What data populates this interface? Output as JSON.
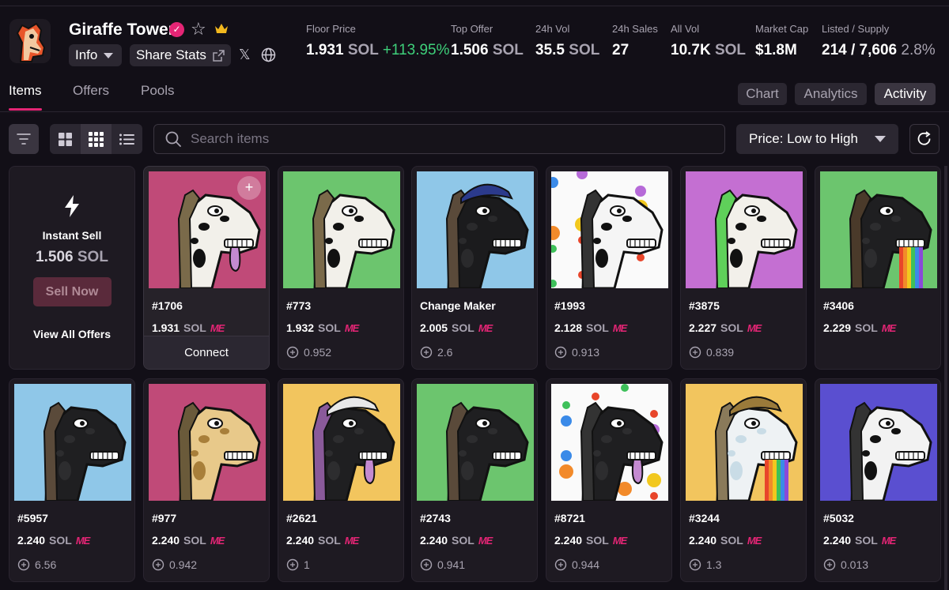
{
  "collection": {
    "name": "Giraffe Tower",
    "info_label": "Info",
    "share_label": "Share Stats"
  },
  "stats": [
    {
      "label": "Floor Price",
      "value": "1.931",
      "unit": "SOL",
      "extra": "+113.95%"
    },
    {
      "label": "Top Offer",
      "value": "1.506",
      "unit": "SOL"
    },
    {
      "label": "24h Vol",
      "value": "35.5",
      "unit": "SOL"
    },
    {
      "label": "24h Sales",
      "value": "27"
    },
    {
      "label": "All Vol",
      "value": "10.7K",
      "unit": "SOL"
    },
    {
      "label": "Market Cap",
      "value": "$1.8M"
    },
    {
      "label": "Listed / Supply",
      "value": "214 / 7,606",
      "extra": "2.8%"
    }
  ],
  "tabs": [
    "Items",
    "Offers",
    "Pools"
  ],
  "views": [
    "Chart",
    "Analytics",
    "Activity"
  ],
  "search": {
    "placeholder": "Search items"
  },
  "sort": {
    "selected": "Price: Low to High"
  },
  "instant_sell": {
    "title": "Instant Sell",
    "price": "1.506",
    "unit": "SOL",
    "button": "Sell Now",
    "view_all": "View All Offers"
  },
  "price_unit": "SOL",
  "marketplace_mark": "ME",
  "connect_label": "Connect",
  "items": [
    {
      "name": "#1706",
      "price": "1.931",
      "last": "",
      "bg": "#c04a78",
      "body": "#f2f0ea",
      "spots": "#111111",
      "mane": "#7a6a4a",
      "tongue": true
    },
    {
      "name": "#773",
      "price": "1.932",
      "last": "0.952",
      "bg": "#6cc56e",
      "body": "#f2f0ea",
      "spots": "#111111",
      "mane": "#7a6a4a"
    },
    {
      "name": "Change Maker",
      "price": "2.005",
      "last": "2.6",
      "bg": "#8fc7e8",
      "body": "#1b1b1d",
      "spots": "#2a2a2c",
      "mane": "#5a4a3a",
      "hat": "#2b3a8c"
    },
    {
      "name": "#1993",
      "price": "2.128",
      "last": "0.913",
      "bg": "#fafafa",
      "body": "#f5f5f5",
      "spots": "#111111",
      "mane": "#333333",
      "dots": true
    },
    {
      "name": "#3875",
      "price": "2.227",
      "last": "0.839",
      "bg": "#c46fd2",
      "body": "#f2f0ea",
      "spots": "#111111",
      "mane": "#5fd05a"
    },
    {
      "name": "#3406",
      "price": "2.229",
      "last": "",
      "bg": "#6cc56e",
      "body": "#1f1f21",
      "spots": "#2d2d2f",
      "mane": "#4a3a2a",
      "rainbow": true
    },
    {
      "name": "#5957",
      "price": "2.240",
      "last": "6.56",
      "bg": "#8fc7e8",
      "body": "#1f1f21",
      "spots": "#2d2d2f",
      "mane": "#5a4a3a"
    },
    {
      "name": "#977",
      "price": "2.240",
      "last": "0.942",
      "bg": "#c04a78",
      "body": "#e8c98a",
      "spots": "#a87f3a",
      "mane": "#6a5a3a"
    },
    {
      "name": "#2621",
      "price": "2.240",
      "last": "1",
      "bg": "#f2c55e",
      "body": "#1f1f21",
      "spots": "#2d2d2f",
      "mane": "#8a5a9a",
      "tongue": true,
      "hat": "#e8e8e8"
    },
    {
      "name": "#2743",
      "price": "2.240",
      "last": "0.941",
      "bg": "#6cc56e",
      "body": "#1f1f21",
      "spots": "#2d2d2f",
      "mane": "#5a4a3a"
    },
    {
      "name": "#8721",
      "price": "2.240",
      "last": "0.944",
      "bg": "#fafafa",
      "body": "#1f1f21",
      "spots": "#2d2d2f",
      "mane": "#333333",
      "tongue": true,
      "dots": true
    },
    {
      "name": "#3244",
      "price": "2.240",
      "last": "1.3",
      "bg": "#f2c55e",
      "body": "#eef2f4",
      "spots": "#c9dce6",
      "mane": "#8a7a5a",
      "rainbow": true,
      "hat": "#9a7a3a"
    },
    {
      "name": "#5032",
      "price": "2.240",
      "last": "0.013",
      "bg": "#5a4fd0",
      "body": "#f2f2f2",
      "spots": "#111111",
      "mane": "#333333"
    }
  ]
}
